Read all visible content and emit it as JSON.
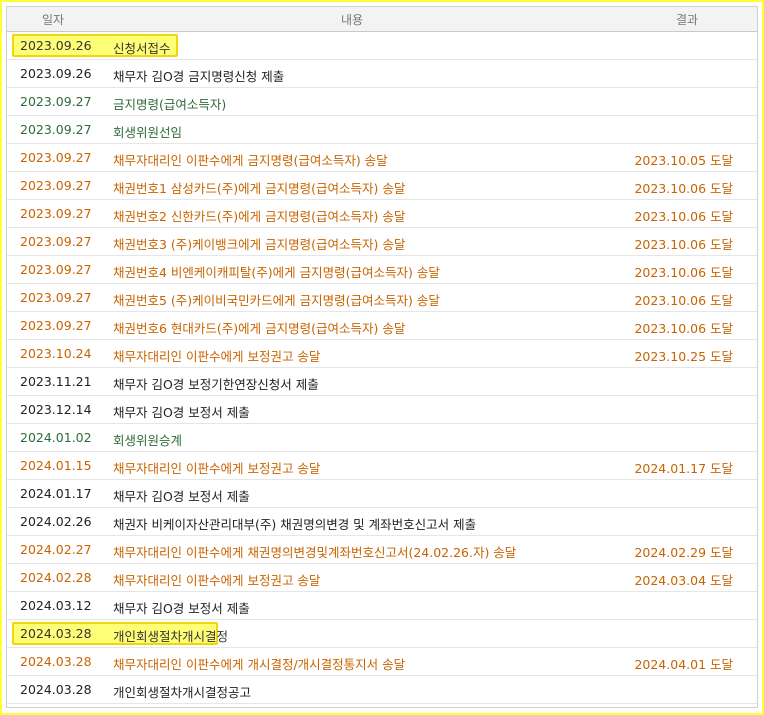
{
  "header": {
    "date": "일자",
    "content": "내용",
    "result": "결과"
  },
  "rows": [
    {
      "date": "2023.09.26",
      "content": "신청서접수",
      "result": "",
      "tone": "hlrow",
      "highlight": true
    },
    {
      "date": "2023.09.26",
      "content": "채무자 김O경 금지명령신청 제출",
      "result": "",
      "tone": "black"
    },
    {
      "date": "2023.09.27",
      "content": "금지명령(급여소득자)",
      "result": "",
      "tone": "green"
    },
    {
      "date": "2023.09.27",
      "content": "회생위원선임",
      "result": "",
      "tone": "green"
    },
    {
      "date": "2023.09.27",
      "content": "채무자대리인 이판수에게 금지명령(급여소득자) 송달",
      "result": "2023.10.05 도달",
      "tone": "orange"
    },
    {
      "date": "2023.09.27",
      "content": "채권번호1 삼성카드(주)에게 금지명령(급여소득자) 송달",
      "result": "2023.10.06 도달",
      "tone": "orange"
    },
    {
      "date": "2023.09.27",
      "content": "채권번호2 신한카드(주)에게 금지명령(급여소득자) 송달",
      "result": "2023.10.06 도달",
      "tone": "orange"
    },
    {
      "date": "2023.09.27",
      "content": "채권번호3 (주)케이뱅크에게 금지명령(급여소득자) 송달",
      "result": "2023.10.06 도달",
      "tone": "orange"
    },
    {
      "date": "2023.09.27",
      "content": "채권번호4 비엔케이캐피탈(주)에게 금지명령(급여소득자) 송달",
      "result": "2023.10.06 도달",
      "tone": "orange"
    },
    {
      "date": "2023.09.27",
      "content": "채권번호5 (주)케이비국민카드에게 금지명령(급여소득자) 송달",
      "result": "2023.10.06 도달",
      "tone": "orange"
    },
    {
      "date": "2023.09.27",
      "content": "채권번호6 현대카드(주)에게 금지명령(급여소득자) 송달",
      "result": "2023.10.06 도달",
      "tone": "orange"
    },
    {
      "date": "2023.10.24",
      "content": "채무자대리인 이판수에게 보정권고 송달",
      "result": "2023.10.25 도달",
      "tone": "orange"
    },
    {
      "date": "2023.11.21",
      "content": "채무자 김O경 보정기한연장신청서 제출",
      "result": "",
      "tone": "black"
    },
    {
      "date": "2023.12.14",
      "content": "채무자 김O경 보정서 제출",
      "result": "",
      "tone": "black"
    },
    {
      "date": "2024.01.02",
      "content": "회생위원승계",
      "result": "",
      "tone": "green"
    },
    {
      "date": "2024.01.15",
      "content": "채무자대리인 이판수에게 보정권고 송달",
      "result": "2024.01.17 도달",
      "tone": "orange"
    },
    {
      "date": "2024.01.17",
      "content": "채무자 김O경 보정서 제출",
      "result": "",
      "tone": "black"
    },
    {
      "date": "2024.02.26",
      "content": "채권자 비케이자산관리대부(주) 채권명의변경 및 계좌번호신고서 제출",
      "result": "",
      "tone": "black"
    },
    {
      "date": "2024.02.27",
      "content": "채무자대리인 이판수에게 채권명의변경및계좌번호신고서(24.02.26.자) 송달",
      "result": "2024.02.29 도달",
      "tone": "orange"
    },
    {
      "date": "2024.02.28",
      "content": "채무자대리인 이판수에게 보정권고 송달",
      "result": "2024.03.04 도달",
      "tone": "orange"
    },
    {
      "date": "2024.03.12",
      "content": "채무자 김O경 보정서 제출",
      "result": "",
      "tone": "black"
    },
    {
      "date": "2024.03.28",
      "content": "개인회생절차개시결정",
      "result": "",
      "tone": "hlrow",
      "highlight": true,
      "wide": true
    },
    {
      "date": "2024.03.28",
      "content": "채무자대리인 이판수에게 개시결정/개시결정통지서 송달",
      "result": "2024.04.01 도달",
      "tone": "orange"
    },
    {
      "date": "2024.03.28",
      "content": "개인회생절차개시결정공고",
      "result": "",
      "tone": "black"
    }
  ]
}
